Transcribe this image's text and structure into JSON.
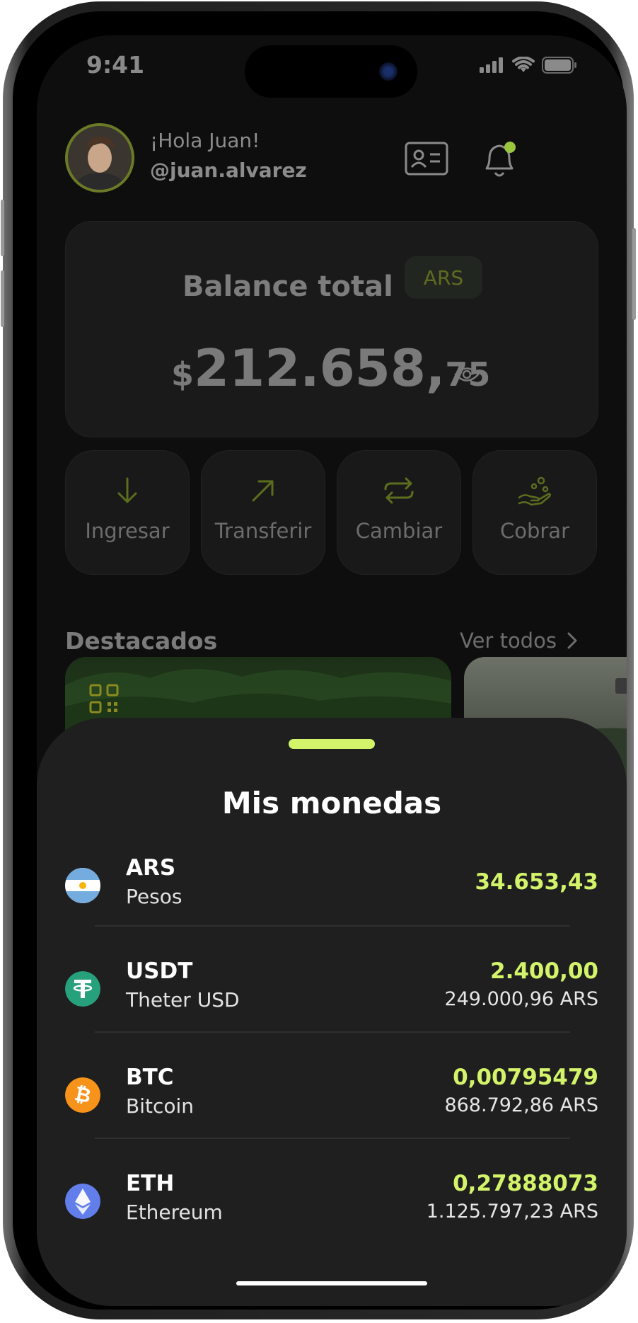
{
  "status_bar": {
    "time": "9:41"
  },
  "header": {
    "greeting": "¡Hola Juan!",
    "handle": "@juan.alvarez",
    "contact_card_icon": "id-card-icon",
    "notification_icon": "bell-icon",
    "notification_dot_color": "#9bc53d"
  },
  "balance": {
    "title": "Balance total",
    "currency_chip": "ARS",
    "currency_symbol": "$",
    "amount_integer": "212.658,",
    "amount_decimals": "75"
  },
  "actions": [
    {
      "label": "Ingresar",
      "icon": "arrow-down-icon"
    },
    {
      "label": "Transferir",
      "icon": "arrow-up-right-icon"
    },
    {
      "label": "Cambiar",
      "icon": "exchange-icon"
    },
    {
      "label": "Cobrar",
      "icon": "hand-coins-icon"
    }
  ],
  "featured": {
    "title": "Destacados",
    "see_all": "Ver todos"
  },
  "wallet": {
    "title": "Mis monedas",
    "items": [
      {
        "code": "ARS",
        "name": "Pesos",
        "amount": "34.653,43",
        "converted": ""
      },
      {
        "code": "USDT",
        "name": "Theter USD",
        "amount": "2.400,00",
        "converted": "249.000,96 ARS"
      },
      {
        "code": "BTC",
        "name": "Bitcoin",
        "amount": "0,00795479",
        "converted": "868.792,86 ARS"
      },
      {
        "code": "ETH",
        "name": "Ethereum",
        "amount": "0,27888073",
        "converted": "1.125.797,23 ARS"
      }
    ]
  },
  "colors": {
    "accent": "#d3f46a",
    "sheet_bg": "#1f1f1f",
    "screen_bg": "#0e0e0e"
  }
}
